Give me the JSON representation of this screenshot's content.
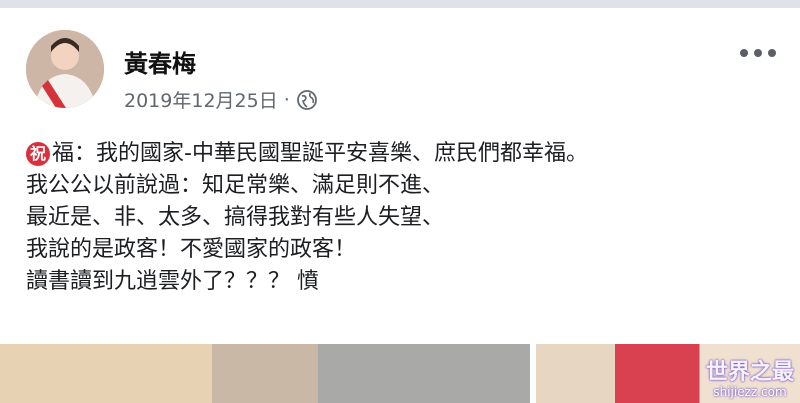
{
  "post": {
    "author": "黃春梅",
    "date": "2019年12月25日",
    "separator": "·",
    "icons": {
      "privacy": "globe-icon",
      "more": "more-options-icon",
      "blessing": "blessing-icon"
    },
    "blessing_char": "祝",
    "lines": [
      "福：我的國家-中華民國聖誕平安喜樂、庶民們都幸福。",
      "我公公以前說過：知足常樂、滿足則不進、",
      "最近是、非、太多、搞得我對有些人失望、",
      "我說的是政客！不愛國家的政客！",
      "讀書讀到九逍雲外了？？？ 憤"
    ]
  },
  "watermark": {
    "title": "世界之最",
    "url": "shijiezz.com"
  },
  "colors": {
    "text": "#1c1e21",
    "meta": "#606770",
    "blessing": "#d8303c"
  }
}
